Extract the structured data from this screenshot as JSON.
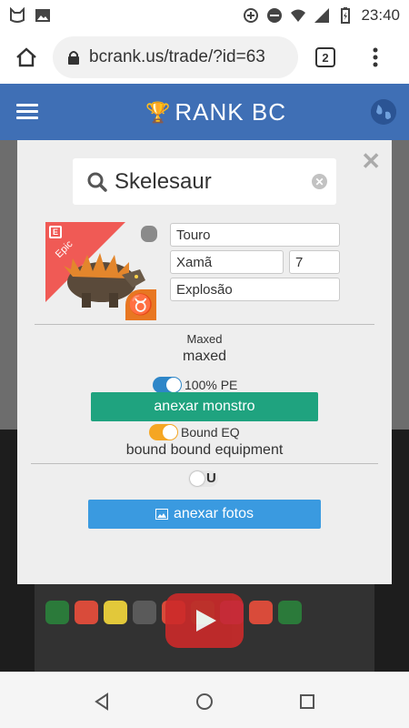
{
  "status_bar": {
    "time": "23:40",
    "icons": [
      "cat-icon",
      "image-icon",
      "data-saver-icon",
      "dnd-icon",
      "wifi-icon",
      "signal-icon",
      "battery-icon"
    ]
  },
  "browser": {
    "url": "bcrank.us/trade/?id=63",
    "tab_count": "2"
  },
  "site": {
    "logo_text": "RANK BC",
    "colors": {
      "header": "#3f6fb5",
      "trophy": "#f5b22a"
    }
  },
  "modal": {
    "search": {
      "value": "Skelesaur"
    },
    "monster": {
      "rarity": "Epic",
      "rarity_color": "#f05a55",
      "zodiac": "♉",
      "fields": {
        "sign": "Touro",
        "class": "Xamã",
        "stars": "7",
        "element": "Explosão"
      }
    },
    "maxed_label": "Maxed",
    "maxed_value": "maxed",
    "pe_toggle": {
      "label": "100% PE",
      "on": true,
      "color": "#2e86c8"
    },
    "attach_monster_button": "anexar monstro",
    "bound_toggle": {
      "label": "Bound EQ",
      "on": true,
      "color": "#f5a623"
    },
    "bound_value": "bound bound equipment",
    "extra_toggle": {
      "label": "U",
      "on": false
    },
    "attach_photos_button": "anexar fotos",
    "colors": {
      "attach_monster": "#1fa37f",
      "attach_photos": "#3a9ae0"
    }
  }
}
